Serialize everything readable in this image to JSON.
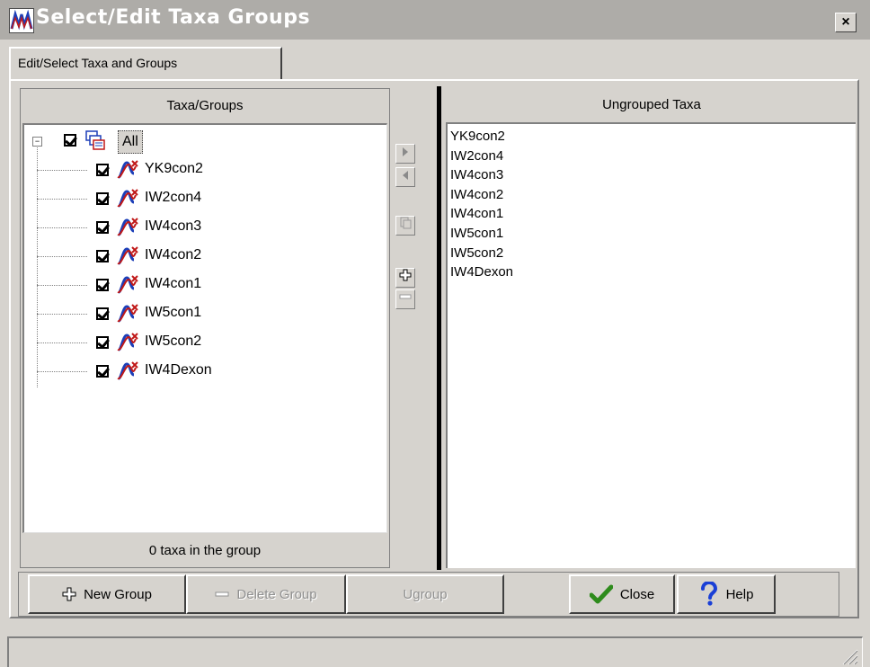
{
  "window": {
    "title": "Select/Edit Taxa Groups",
    "close_glyph": "×"
  },
  "tab": {
    "label": "Edit/Select Taxa and Groups"
  },
  "left_panel": {
    "header": "Taxa/Groups",
    "root": {
      "label": "All",
      "checked": true,
      "expander": "−"
    },
    "taxa": [
      {
        "label": "YK9con2",
        "checked": true
      },
      {
        "label": "IW2con4",
        "checked": true
      },
      {
        "label": "IW4con3",
        "checked": true
      },
      {
        "label": "IW4con2",
        "checked": true
      },
      {
        "label": "IW4con1",
        "checked": true
      },
      {
        "label": "IW5con1",
        "checked": true
      },
      {
        "label": "IW5con2",
        "checked": true
      },
      {
        "label": "IW4Dexon",
        "checked": true
      }
    ],
    "footer": "0 taxa in the group"
  },
  "mid_toolbar": {
    "move_right_icon": "arrow-right-icon",
    "move_left_icon": "arrow-left-icon",
    "edit_icon": "page-icon",
    "add_icon": "plus-icon",
    "remove_icon": "minus-icon"
  },
  "right_panel": {
    "header": "Ungrouped Taxa",
    "items": [
      "YK9con2",
      "IW2con4",
      "IW4con3",
      "IW4con2",
      "IW4con1",
      "IW5con1",
      "IW5con2",
      "IW4Dexon"
    ]
  },
  "buttons": {
    "new_group": "New Group",
    "delete_group": "Delete Group",
    "ugroup": "Ugroup",
    "close": "Close",
    "help": "Help"
  },
  "colors": {
    "face": "#d6d3ce",
    "titlebar": "#aeaca8",
    "check_green": "#2e8b1c",
    "help_blue": "#1a3fd6"
  }
}
